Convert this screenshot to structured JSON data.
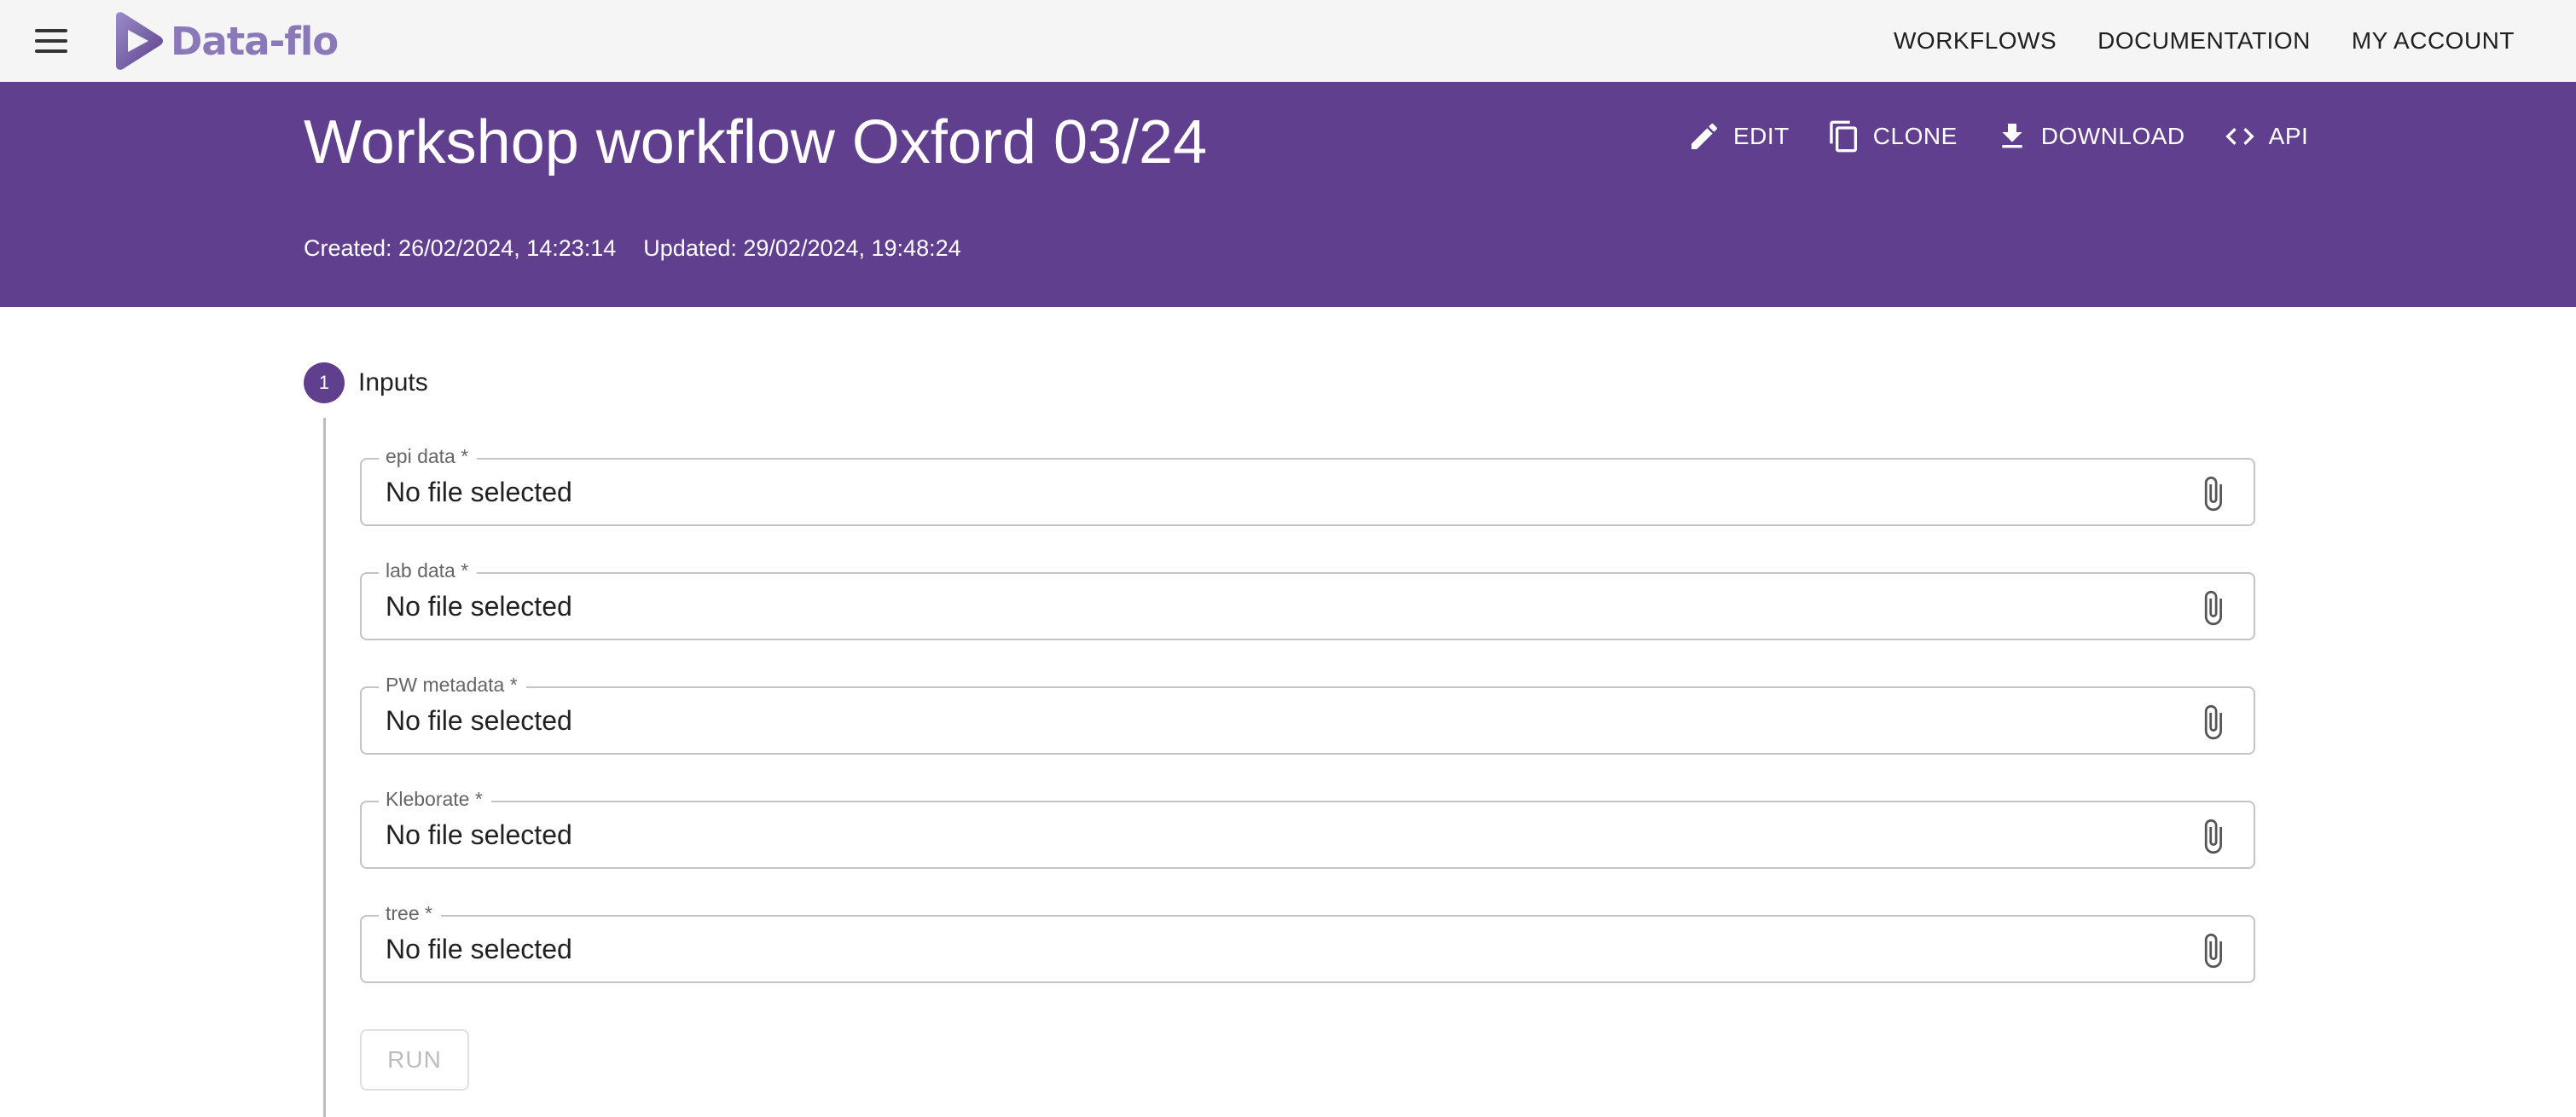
{
  "appbar": {
    "logo_text": "Data-flo",
    "nav": [
      "WORKFLOWS",
      "DOCUMENTATION",
      "MY ACCOUNT"
    ]
  },
  "header": {
    "title": "Workshop workflow Oxford 03/24",
    "actions": {
      "edit": "EDIT",
      "clone": "CLONE",
      "download": "DOWNLOAD",
      "api": "API"
    },
    "created": "Created: 26/02/2024, 14:23:14",
    "updated": "Updated: 29/02/2024, 19:48:24"
  },
  "step": {
    "number": "1",
    "label": "Inputs"
  },
  "inputs": [
    {
      "label": "epi data *",
      "value": "No file selected"
    },
    {
      "label": "lab data *",
      "value": "No file selected"
    },
    {
      "label": "PW metadata *",
      "value": "No file selected"
    },
    {
      "label": "Kleborate *",
      "value": "No file selected"
    },
    {
      "label": "tree *",
      "value": "No file selected"
    }
  ],
  "run_label": "RUN",
  "colors": {
    "brand_purple": "#613f8f",
    "logo_purple": "#8b78b8",
    "appbar_bg": "#f5f5f5"
  }
}
